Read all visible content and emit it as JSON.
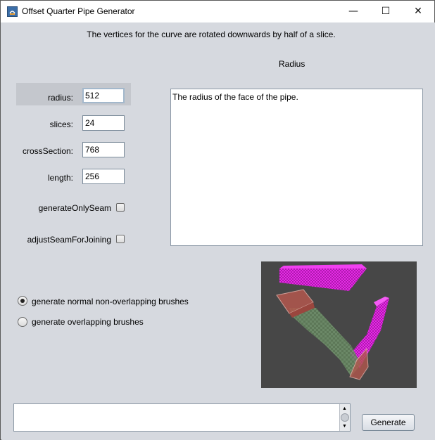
{
  "window": {
    "title": "Offset Quarter Pipe Generator",
    "controls": {
      "minimize": "—",
      "maximize": "☐",
      "close": "✕"
    }
  },
  "description": "The vertices for the curve are rotated downwards by half of a slice.",
  "help": {
    "heading": "Radius",
    "text": "The radius of the face of the pipe."
  },
  "params": [
    {
      "label": "radius:",
      "value": "512"
    },
    {
      "label": "slices:",
      "value": "24"
    },
    {
      "label": "crossSection:",
      "value": "768"
    },
    {
      "label": "length:",
      "value": "256"
    }
  ],
  "checkboxes": [
    {
      "label": "generateOnlySeam",
      "checked": false
    },
    {
      "label": "adjustSeamForJoining",
      "checked": false
    }
  ],
  "radios": [
    {
      "label": "generate normal non-overlapping brushes",
      "selected": true
    },
    {
      "label": "generate overlapping brushes",
      "selected": false
    }
  ],
  "generate_label": "Generate",
  "colors": {
    "panel_bg": "#d6d9df",
    "preview_bg": "#474747",
    "brush_magenta": "#e020e0",
    "brush_green": "#6f8f6a",
    "brush_red": "#b2574d"
  }
}
